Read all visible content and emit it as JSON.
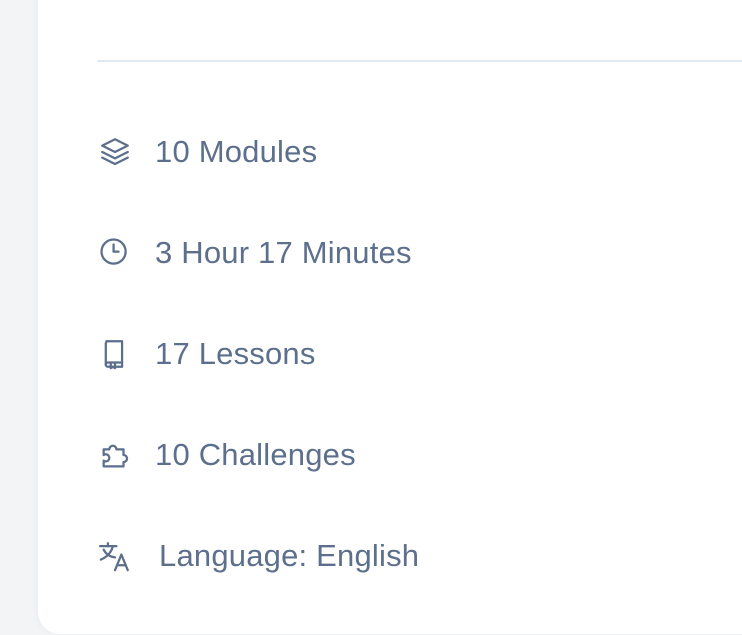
{
  "course_features": {
    "modules": {
      "icon": "layers-icon",
      "label": "10 Modules"
    },
    "duration": {
      "icon": "clock-icon",
      "label": "3 Hour 17 Minutes"
    },
    "lessons": {
      "icon": "book-icon",
      "label": "17 Lessons"
    },
    "challenges": {
      "icon": "puzzle-icon",
      "label": "10 Challenges"
    },
    "language": {
      "icon": "translate-icon",
      "label": "Language: English"
    }
  },
  "colors": {
    "text": "#5c6f8c",
    "divider": "#e2e8f0",
    "card_background": "#ffffff",
    "page_background": "#f3f4f6"
  }
}
